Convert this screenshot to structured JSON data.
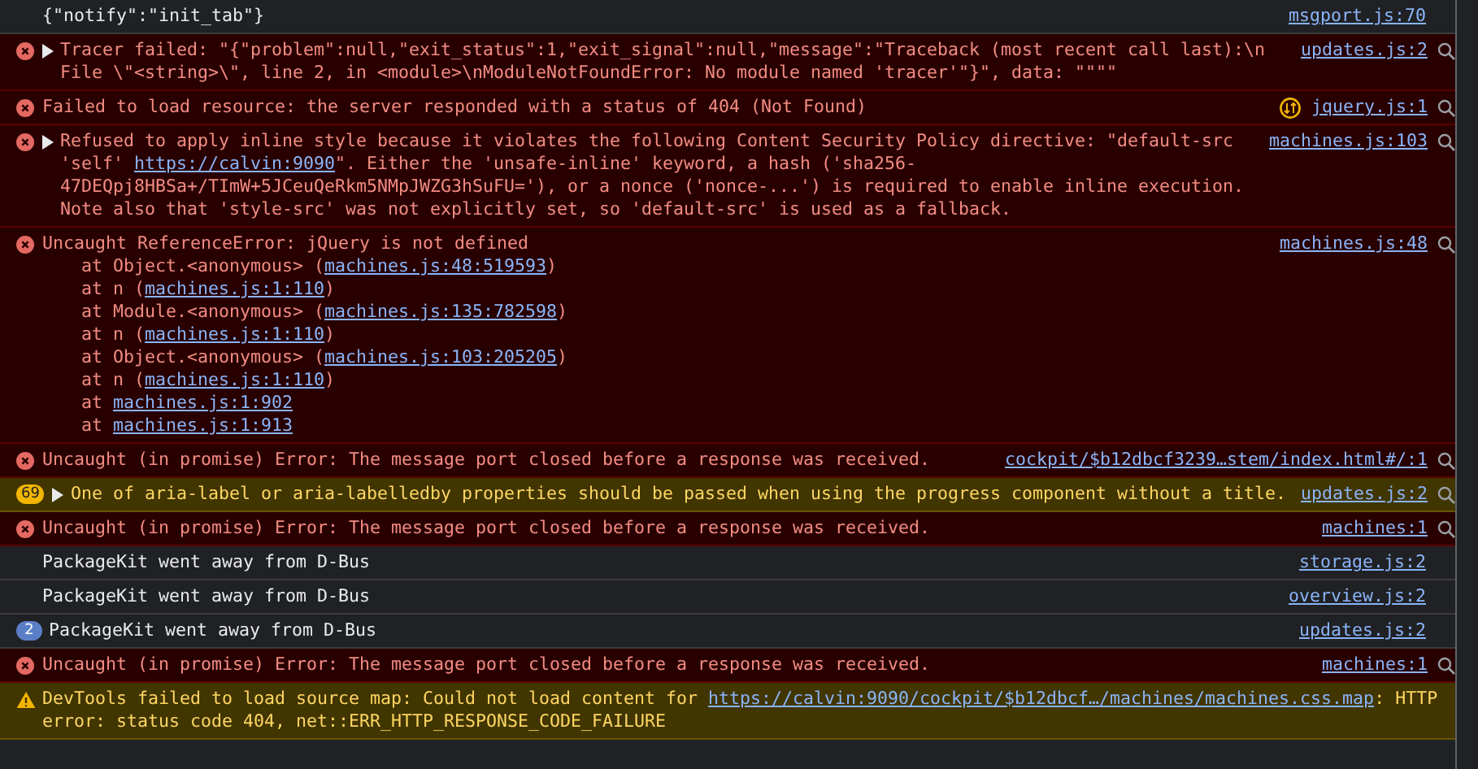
{
  "console": {
    "messages": [
      {
        "kind": "log",
        "message": [
          {
            "text": "{\"notify\":\"init_tab\"}"
          }
        ],
        "source": "msgport.js:70"
      },
      {
        "kind": "error",
        "expanded": false,
        "message": [
          {
            "text": "Tracer failed: \"{\"problem\":null,\"exit_status\":1,\"exit_signal\":null,\"message\":\"Traceback (most recent call last):\\n  File \\\"<string>\\\", line 2, in <module>\\nModuleNotFoundError: No module named 'tracer'\"}\", data: \"\"\"\""
          }
        ],
        "source": "updates.js:2"
      },
      {
        "kind": "error",
        "issue": true,
        "message": [
          {
            "text": "Failed to load resource: the server responded with a status of 404 (Not Found)"
          }
        ],
        "source": "jquery.js:1"
      },
      {
        "kind": "error",
        "expanded": false,
        "message": [
          {
            "text": "Refused to apply inline style because it violates the following Content Security Policy directive: \"default-src 'self' "
          },
          {
            "link": "https://calvin:9090"
          },
          {
            "text": "\". Either the 'unsafe-inline' keyword, a hash ('sha256-47DEQpj8HBSa+/TImW+5JCeuQeRkm5NMpJWZG3hSuFU='), or a nonce ('nonce-...') is required to enable inline execution. Note also that 'style-src' was not explicitly set, so 'default-src' is used as a fallback."
          }
        ],
        "source": "machines.js:103"
      },
      {
        "kind": "error",
        "message": [
          {
            "text": "Uncaught ReferenceError: jQuery is not defined"
          }
        ],
        "source": "machines.js:48",
        "stack": [
          [
            {
              "text": "at Object.<anonymous> ("
            },
            {
              "link": "machines.js:48:519593"
            },
            {
              "text": ")"
            }
          ],
          [
            {
              "text": "at n ("
            },
            {
              "link": "machines.js:1:110"
            },
            {
              "text": ")"
            }
          ],
          [
            {
              "text": "at Module.<anonymous> ("
            },
            {
              "link": "machines.js:135:782598"
            },
            {
              "text": ")"
            }
          ],
          [
            {
              "text": "at n ("
            },
            {
              "link": "machines.js:1:110"
            },
            {
              "text": ")"
            }
          ],
          [
            {
              "text": "at Object.<anonymous> ("
            },
            {
              "link": "machines.js:103:205205"
            },
            {
              "text": ")"
            }
          ],
          [
            {
              "text": "at n ("
            },
            {
              "link": "machines.js:1:110"
            },
            {
              "text": ")"
            }
          ],
          [
            {
              "text": "at "
            },
            {
              "link": "machines.js:1:902"
            }
          ],
          [
            {
              "text": "at "
            },
            {
              "link": "machines.js:1:913"
            }
          ]
        ]
      },
      {
        "kind": "error",
        "message": [
          {
            "text": "Uncaught (in promise) Error: The message port closed before a response was received."
          }
        ],
        "source": "cockpit/$b12dbcf3239…stem/index.html#/:1"
      },
      {
        "kind": "warning",
        "count": "69",
        "expanded": false,
        "message": [
          {
            "text": "One of aria-label or aria-labelledby properties should be passed when using the progress component without a title."
          }
        ],
        "source": "updates.js:2"
      },
      {
        "kind": "error",
        "message": [
          {
            "text": "Uncaught (in promise) Error: The message port closed before a response was received."
          }
        ],
        "source": "machines:1"
      },
      {
        "kind": "log",
        "message": [
          {
            "text": "PackageKit went away from D-Bus"
          }
        ],
        "source": "storage.js:2"
      },
      {
        "kind": "log",
        "message": [
          {
            "text": "PackageKit went away from D-Bus"
          }
        ],
        "source": "overview.js:2"
      },
      {
        "kind": "log",
        "count": "2",
        "message": [
          {
            "text": "PackageKit went away from D-Bus"
          }
        ],
        "source": "updates.js:2"
      },
      {
        "kind": "error",
        "message": [
          {
            "text": "Uncaught (in promise) Error: The message port closed before a response was received."
          }
        ],
        "source": "machines:1"
      },
      {
        "kind": "warning",
        "message": [
          {
            "text": "DevTools failed to load source map: Could not load content for "
          },
          {
            "link": "https://calvin:9090/cockpit/$b12dbcf…/machines/machines.css.map"
          },
          {
            "text": ": HTTP error: status code 404, net::ERR_HTTP_RESPONSE_CODE_FAILURE"
          }
        ]
      }
    ]
  }
}
